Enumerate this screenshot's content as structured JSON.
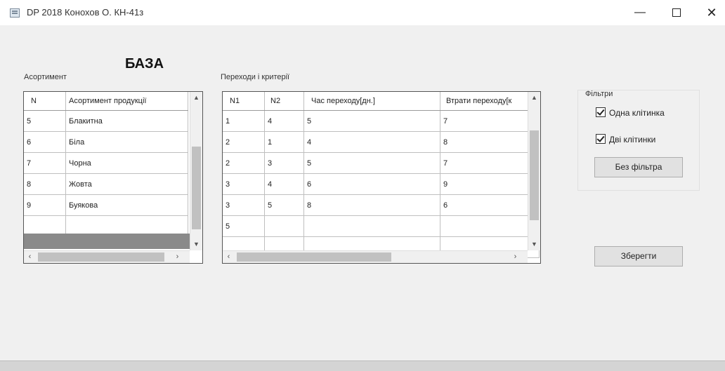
{
  "window": {
    "title": "DP 2018   Конохов О. КН-41з"
  },
  "heading": "БАЗА",
  "assortment": {
    "label": "Асортимент",
    "columns": [
      "N",
      "Асортимент продукції"
    ],
    "rows": [
      [
        "5",
        "Блакитна"
      ],
      [
        "6",
        "Біла"
      ],
      [
        "7",
        "Чорна"
      ],
      [
        "8",
        "Жовта"
      ],
      [
        "9",
        "Буякова"
      ]
    ]
  },
  "transitions": {
    "label": "Переходи  і критерії",
    "columns": [
      "N1",
      "N2",
      "Час переходу[дн.]",
      "Втрати переходу[к"
    ],
    "rows": [
      [
        "1",
        "4",
        "5",
        "7"
      ],
      [
        "2",
        "1",
        "4",
        "8"
      ],
      [
        "2",
        "3",
        "5",
        "7"
      ],
      [
        "3",
        "4",
        "6",
        "9"
      ],
      [
        "3",
        "5",
        "8",
        "6"
      ],
      [
        "5",
        "",
        "",
        ""
      ]
    ]
  },
  "filters": {
    "label": "Фільтри",
    "one_cell": "Одна клітинка",
    "two_cells": "Дві клітинки",
    "no_filter": "Без фільтра"
  },
  "save_button": "Зберегти"
}
